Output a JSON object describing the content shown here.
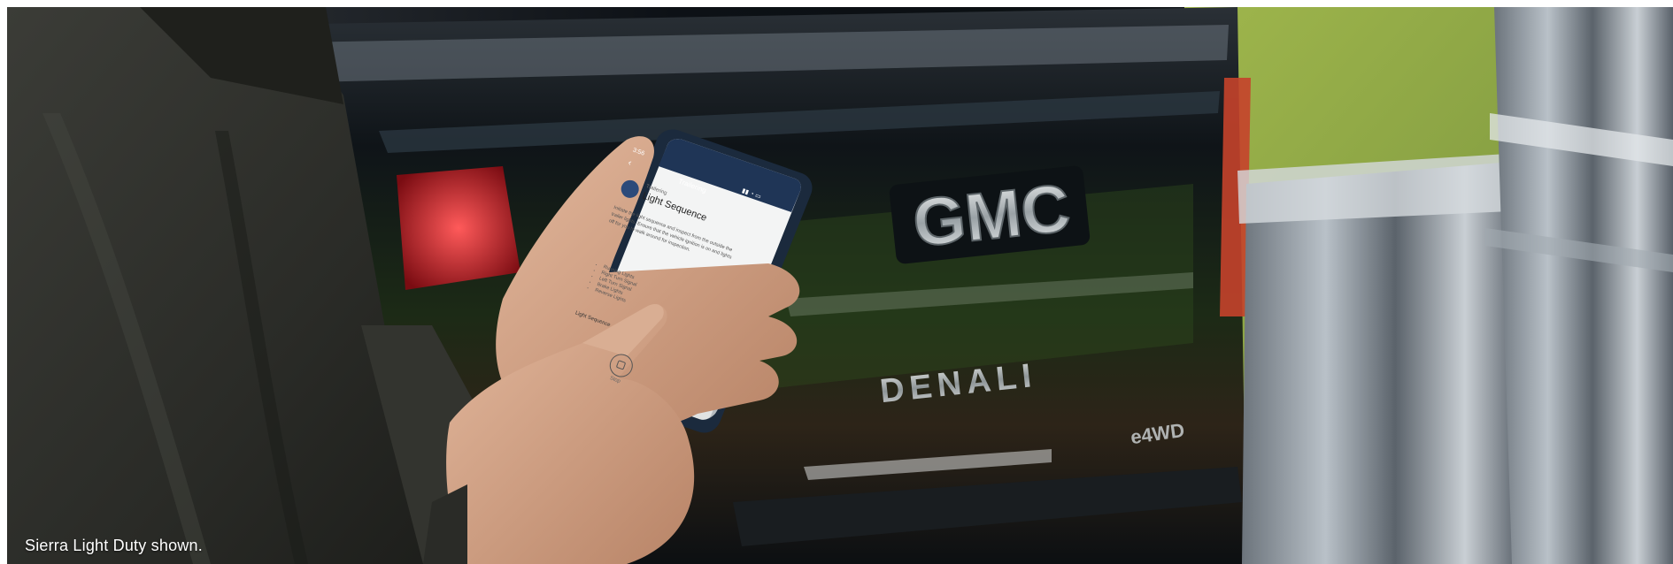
{
  "caption": "Sierra Light Duty shown.",
  "tailgate": {
    "badge": "GMC",
    "trim": "DENALI",
    "sub_badge": "e4WD"
  },
  "phone": {
    "status_time": "3:56",
    "status_icons": "▮▮ ◔ ▭",
    "nav_title": "Trailering",
    "back_glyph": "‹",
    "feature_kicker": "Trailering",
    "feature_title": "Light Sequence",
    "body_text": "Initiate the light sequence and inspect from the outside the trailer lights. Ensure that the vehicle ignition is on and lights off for you to walk around for inspection.",
    "list_items": [
      "Running Lights",
      "Right Turn Signal",
      "Left Turn Signal",
      "Brake Lights",
      "Reverse Lights"
    ],
    "section_label": "Light Sequence",
    "stop_label": "Stop"
  },
  "colors": {
    "truck_body": "#0b1013",
    "grass": "#a8bb58",
    "jacket": "#2e2f2c",
    "phone_bezel": "#1b2a3d",
    "screen_bg": "#f3f4f4"
  }
}
